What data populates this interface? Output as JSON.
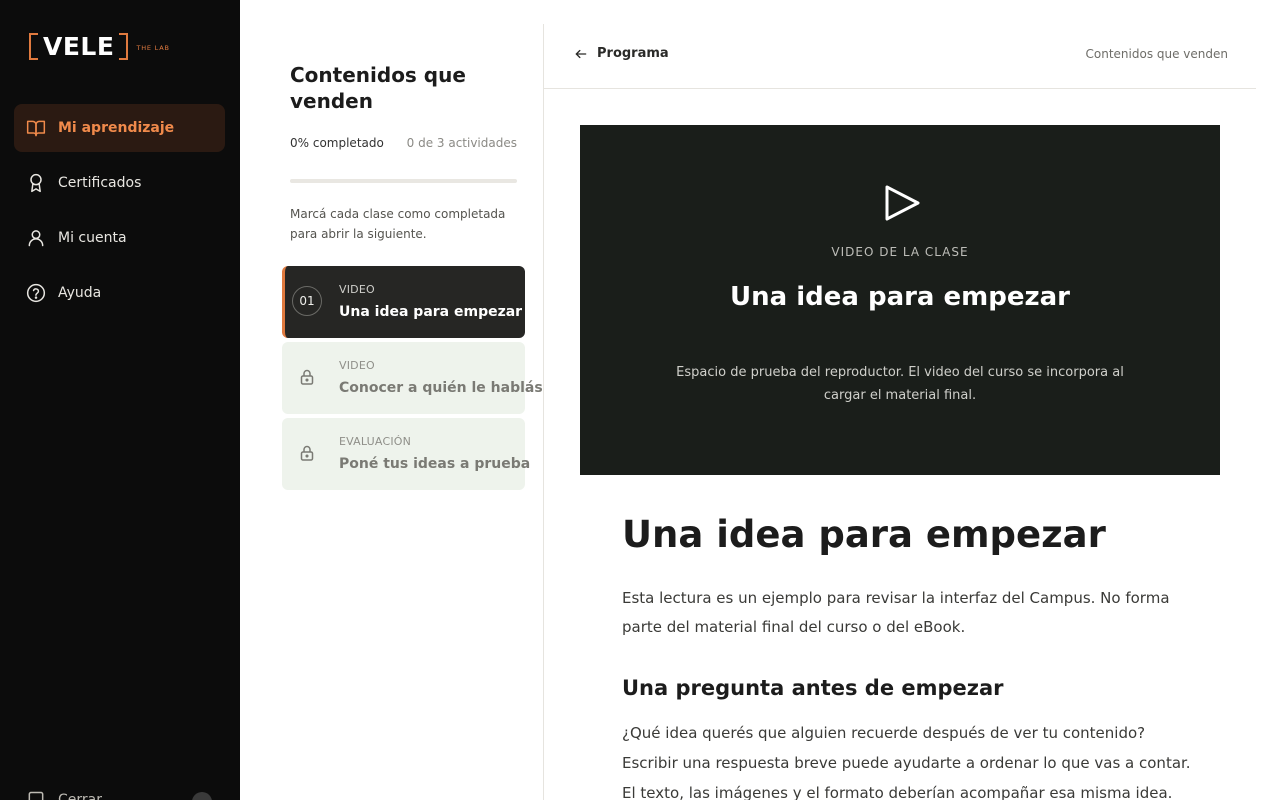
{
  "brand": {
    "name": "VELE",
    "tagline": "THE LAB",
    "accent": "#e07a3f"
  },
  "sidebar": {
    "items": [
      {
        "label": "Mi aprendizaje",
        "icon": "book-icon",
        "active": true
      },
      {
        "label": "Certificados",
        "icon": "award-icon",
        "active": false
      },
      {
        "label": "Mi cuenta",
        "icon": "user-icon",
        "active": false
      },
      {
        "label": "Ayuda",
        "icon": "help-icon",
        "active": false
      }
    ],
    "bottom_label": "Cerrar"
  },
  "course": {
    "title": "Contenidos que venden",
    "progress_text": "0% completado",
    "progress_percent": 0,
    "activities_text": "0 de 3 actividades",
    "hint": "Marcá cada clase como completada para abrir la siguiente.",
    "lessons": [
      {
        "number": "01",
        "type": "VIDEO",
        "title": "Una idea para empezar",
        "locked": false,
        "active": true
      },
      {
        "type": "VIDEO",
        "title": "Conocer a quién le hablás",
        "locked": true,
        "active": false
      },
      {
        "type": "EVALUACIÓN",
        "title": "Poné tus ideas a prueba",
        "locked": true,
        "active": false
      }
    ]
  },
  "header": {
    "back_label": "Programa",
    "course_name": "Contenidos que venden"
  },
  "video": {
    "label": "VIDEO DE LA CLASE",
    "title": "Una idea para empezar",
    "description": "Espacio de prueba del reproductor. El video del curso se incorpora al cargar el material final."
  },
  "article": {
    "title": "Una idea para empezar",
    "intro": "Esta lectura es un ejemplo para revisar la interfaz del Campus. No forma parte del material final del curso o del eBook.",
    "section_title": "Una pregunta antes de empezar",
    "body": "¿Qué idea querés que alguien recuerde después de ver tu contenido? Escribir una respuesta breve puede ayudarte a ordenar lo que vas a contar. El texto, las imágenes y el formato deberían acompañar esa misma idea."
  }
}
